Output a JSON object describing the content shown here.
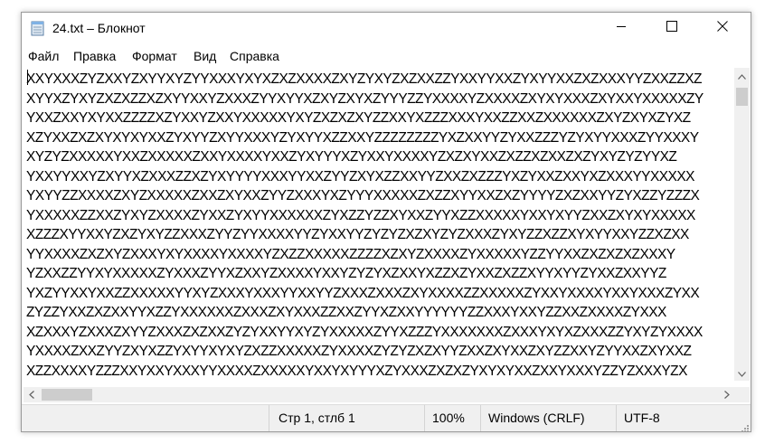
{
  "window": {
    "title": "24.txt – Блокнот",
    "buttons": {
      "minimize": "minimize-icon",
      "maximize": "maximize-icon",
      "close": "close-icon"
    }
  },
  "menu": {
    "items": [
      {
        "label": "Файл"
      },
      {
        "label": "Правка"
      },
      {
        "label": "Формат"
      },
      {
        "label": "Вид"
      },
      {
        "label": "Справка"
      }
    ]
  },
  "editor": {
    "lines": [
      "XXYXXXZYZXXYZXYYXYZYYXXXYXYXZXZXXXXZXYZYXYZXZXXZZYXXYYXXZYXYYXXZXZXXXYYZXXZZXZ",
      "XYYXZYXYZXZXZZXZXYYXXYZXXXZYYXYYXZXYZXYXZYYYZZYXXXXYZXXXXZXYXYXXXZXYXXYXXXXXZY",
      "YXXZXXYXYXXZZZZXZYXXYZXXYXXXXXYXYZXZXZXYZZXXYXZZZXXXYXXZZXXZXXXXXXZXYZXYXZYXZ",
      "XZYXXZXZXYXYXYXXZYXYYZXYYXXXYZYXYYXZZXXYZZZZZZZZYXZXXYYZYXXZZZYZYXYYXXXZYYXXXY",
      "XYZYZXXXXXYXXZXXXXXZXXYXXXXYXXZYXYYYXZYXXYXXXXYZXZXYXXZXZZXZXXZXZYXYZYZYYXZ",
      "YXXYYXXYZXYYXZXXXZZXZYXYYYYXXXYYXXZYYZXYXZZXXYYZXXZXZZZYXZYXXZXXYXZXXXYYXXXXX",
      "YXYYZZXXXXZXYZXXXXXZXXZXYXXZYYZXXXYXZYYYXXXXXZXZZXYYXXZXZYYYYZXZXXYYZYXZZYZZZX",
      "YXXXXXZZXXZYXYZXXXXZYXXZYXYYXXXXXXZYXZZYZZXYXXZYYXZZXXXXXYXXYXYYZXXZXYXYXXXXX",
      "XZZZXYYXXYZXZYXYZZXXXZYYZYYXXXXYYZYXXYYZYZYZXZXYZYZXXXZYXYZZXZZXYXYYXXYZZXZXX",
      "YYXXXXZXZXYZXXXYXYXXXXYXXXXYZXZZXXXXXZZZZXZXYZXXXXZYXXXXXYZZYYXXZXZXZXZXXXY",
      "YZXXZZYYXYXXXXXZYXXXZYYXZXXYZXXXXYXXYZYZYXZXXYXZZXZYXXZXZZXYYXYYZYXXZXXYYZ",
      "YXZYYXXYXXZZXXXXXYYXYZXXXYXXXYYXXYYZXXXZXXXZXYXXXXZZXXXXXZYXXYXXXXYXXYXXXZYXX",
      "ZYZZYXXZXZXXYYXZZYXXXXXXZXXXZXYXXXZZXXZYYXZXXYYYYYYZZXXXYXXYZZXXZXXXXZYXXX",
      "XZXXXYZXXXZXYYZXXXZXZXXZYZYXXYYXYZYXXXXXZYYXZZZYXXXXXXXZXXXYXYXZXXXZZYXYZYXXXX",
      "YXXXXZXXZYYZXYXZZYXYYXYXYZXZZXXXXXZYXXXXZYZYZXZXYYZXXZXYXXZXYZZXXYZYYXXZXYXXZ",
      "XZZXXXXYZZZXXYXXYXXXYYXXXXZXXXXXYXXYXYYYXZYXXXZXZXZYXYXYXXZXXYXXXYZZYZXXXYZX"
    ]
  },
  "statusbar": {
    "position": "Стр 1, стлб 1",
    "zoom": "100%",
    "line_ending": "Windows (CRLF)",
    "encoding": "UTF-8"
  }
}
